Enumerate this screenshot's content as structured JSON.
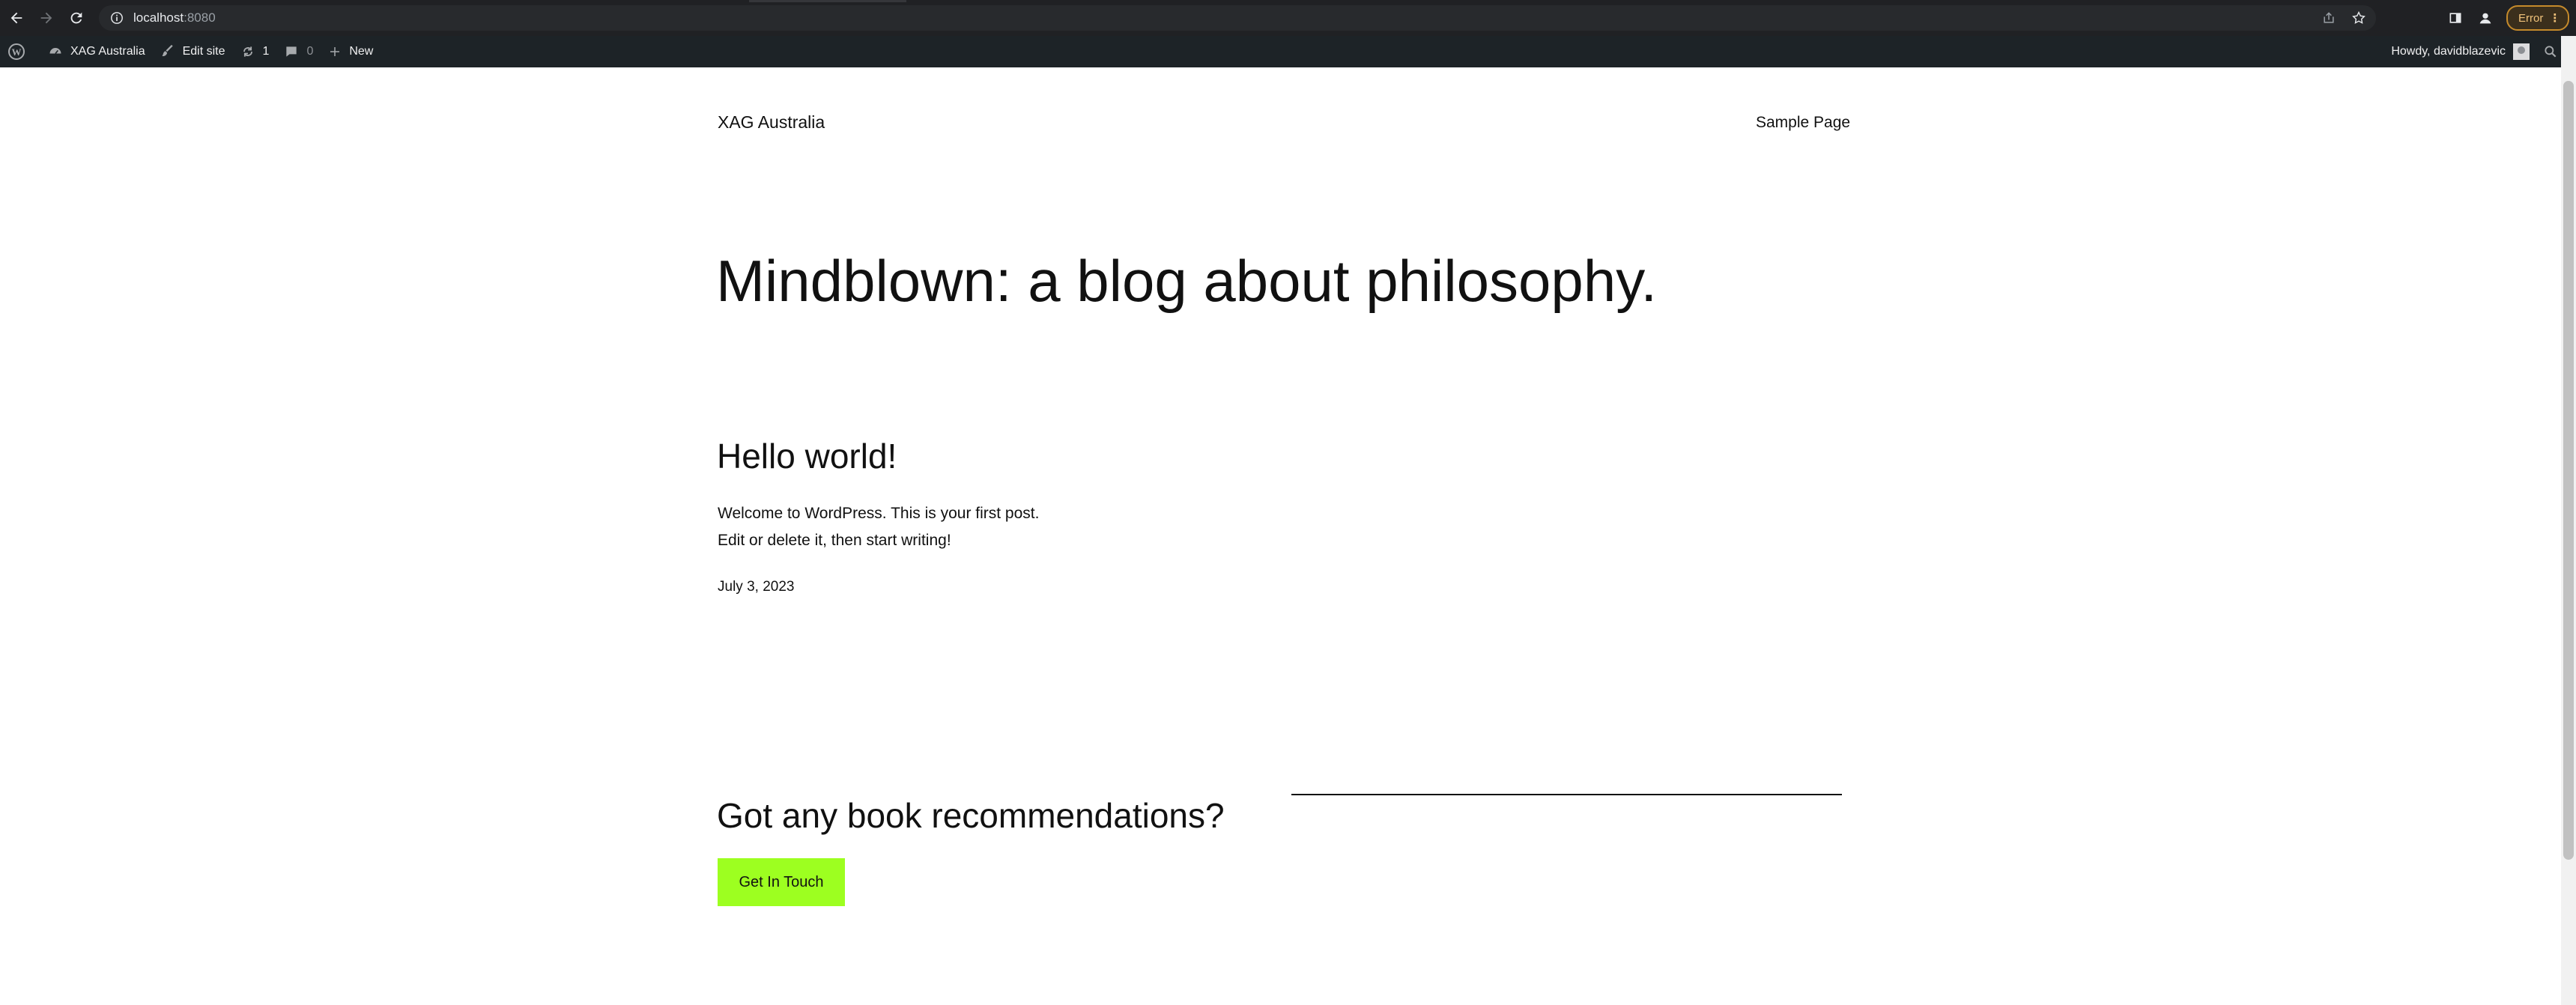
{
  "browser": {
    "url_host": "localhost",
    "url_port": ":8080",
    "error_label": "Error"
  },
  "admin_bar": {
    "site_name": "XAG Australia",
    "edit_site": "Edit site",
    "updates_count": "1",
    "comments_count": "0",
    "new_label": "New",
    "howdy": "Howdy, davidblazevic"
  },
  "site": {
    "title": "XAG Australia",
    "nav": [
      "Sample Page"
    ]
  },
  "main": {
    "hero_heading": "Mindblown: a blog about philosophy.",
    "post": {
      "title": "Hello world!",
      "excerpt_line1": "Welcome to WordPress. This is your first post.",
      "excerpt_line2": "Edit or delete it, then start writing!",
      "date": "July 3, 2023"
    },
    "cta": {
      "heading": "Got any book recommendations?",
      "button_label": "Get In Touch"
    }
  },
  "colors": {
    "button_bg": "#9dff20",
    "admin_bar_bg": "#1d2327",
    "browser_bg": "#202124"
  }
}
